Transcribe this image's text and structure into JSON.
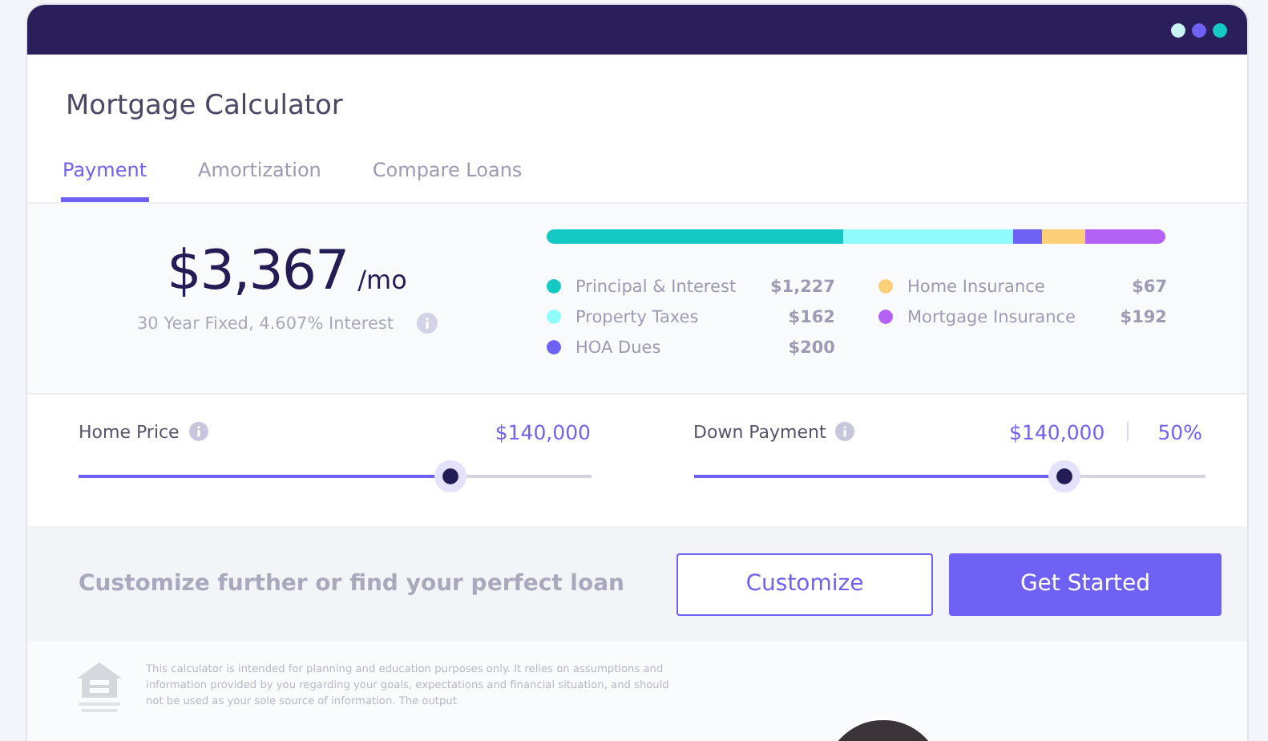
{
  "title": "Mortgage Calculator",
  "tabs": [
    {
      "label": "Payment",
      "selected": true
    },
    {
      "label": "Amortization",
      "selected": false
    },
    {
      "label": "Compare Loans",
      "selected": false
    }
  ],
  "payment": {
    "amount": "$3,367",
    "unit": "/mo",
    "detail": "30 Year Fixed, 4.607% Interest"
  },
  "breakdown": [
    {
      "label": "Principal & Interest",
      "value": "$1,227",
      "color": "#14c8c4"
    },
    {
      "label": "Property Taxes",
      "value": "$162",
      "color": "#8ffcfb"
    },
    {
      "label": "HOA Dues",
      "value": "$200",
      "color": "#7061f5"
    },
    {
      "label": "Home Insurance",
      "value": "$67",
      "color": "#fccf78"
    },
    {
      "label": "Mortgage Insurance",
      "value": "$192",
      "color": "#b462f5"
    }
  ],
  "sliders": [
    {
      "label": "Home Price",
      "value": "$140,000",
      "level": 0.725
    },
    {
      "label": "Down Payment",
      "value": "$140,000",
      "percent": "50%",
      "level": 0.725
    }
  ],
  "cta": {
    "text": "Customize further or find your perfect loan",
    "buttons": [
      {
        "label": "Customize",
        "kind": "outline"
      },
      {
        "label": "Get Started",
        "kind": "filled"
      }
    ]
  },
  "disclaimer": "This calculator is intended for planning and education purposes only. It relies on assumptions and information provided by you regarding your goals, expectations and financial situation, and should not be used as your sole source of information. The output"
}
